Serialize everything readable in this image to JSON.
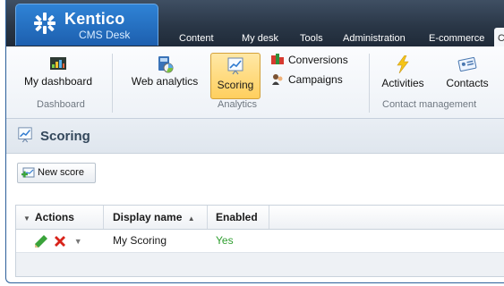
{
  "app": {
    "brand_name": "Kentico",
    "brand_sub": "CMS Desk"
  },
  "top_nav": {
    "items": [
      "Content",
      "My desk",
      "Tools",
      "Administration",
      "E-commerce"
    ],
    "overflow_tab": "C"
  },
  "ribbon": {
    "dashboard": {
      "button": "My dashboard",
      "caption": "Dashboard"
    },
    "analytics": {
      "web_analytics": "Web analytics",
      "scoring": "Scoring",
      "conversions": "Conversions",
      "campaigns": "Campaigns",
      "caption": "Analytics"
    },
    "contact_management": {
      "activities": "Activities",
      "contacts": "Contacts",
      "caption": "Contact management"
    }
  },
  "page": {
    "title": "Scoring",
    "new_button": "New score"
  },
  "grid": {
    "headers": {
      "actions": "Actions",
      "display_name": "Display name",
      "enabled": "Enabled"
    },
    "sort_indicator": "▲",
    "rows": [
      {
        "display_name": "My Scoring",
        "enabled": "Yes"
      }
    ]
  },
  "colors": {
    "accent": "#2f83d6",
    "header_dark": "#2a3747",
    "active_button": "#ffcf5e",
    "enabled_yes": "#2e9e2e"
  }
}
